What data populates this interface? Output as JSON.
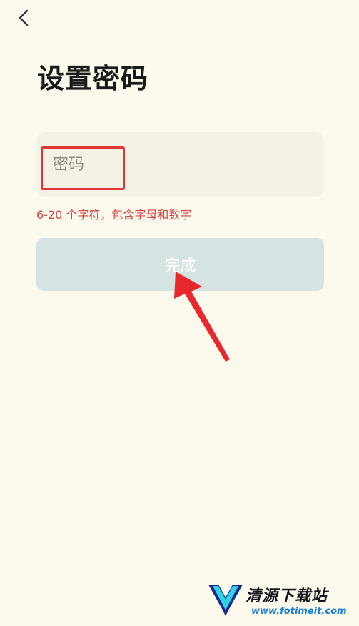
{
  "header": {
    "back_icon": "chevron-left-icon"
  },
  "page": {
    "title": "设置密码"
  },
  "password": {
    "placeholder": "密码",
    "value": ""
  },
  "hint": {
    "text": "6-20 个字符，包含字母和数字",
    "color": "#d64545"
  },
  "submit": {
    "label": "完成",
    "background": "#d6e3e3"
  },
  "annotation": {
    "highlight_color": "#e0363a",
    "arrow_color": "#e8282c"
  },
  "watermark": {
    "name": "清源下载站",
    "url": "www.fotimeit.com"
  },
  "colors": {
    "background": "#fbfaec",
    "input_background": "#f4f2e5"
  }
}
